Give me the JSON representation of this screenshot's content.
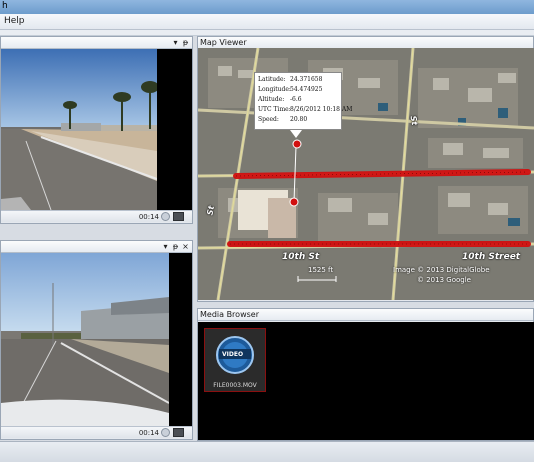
{
  "window": {
    "title_fragment": "h"
  },
  "menu": {
    "help_label": "Help"
  },
  "video_top": {
    "time": "00:14"
  },
  "video_bottom": {
    "time": "00:14"
  },
  "map_viewer": {
    "title": "Map Viewer",
    "popup": {
      "latitude_label": "Latitude:",
      "latitude_value": "24.371658",
      "longitude_label": "Longitude:",
      "longitude_value": "54.474925",
      "altitude_label": "Altitude:",
      "altitude_value": "-6.6",
      "utc_label": "UTC Time:",
      "utc_value": "8/26/2012 10:18 AM",
      "speed_label": "Speed:",
      "speed_value": "20.80"
    },
    "street_labels": {
      "tenth_st": "10th St",
      "tenth_street": "10th Street",
      "st_vertical_left": "St",
      "st_vertical_right": "St"
    },
    "scale": "1525 ft",
    "credit_1": "Image © 2013 DigitalGlobe",
    "credit_2": "© 2013 Google",
    "track_color": "#d10f0f"
  },
  "media_browser": {
    "title": "Media Browser",
    "items": [
      {
        "filename": "FILE0003.MOV",
        "icon_text": "VIDEO"
      }
    ]
  }
}
